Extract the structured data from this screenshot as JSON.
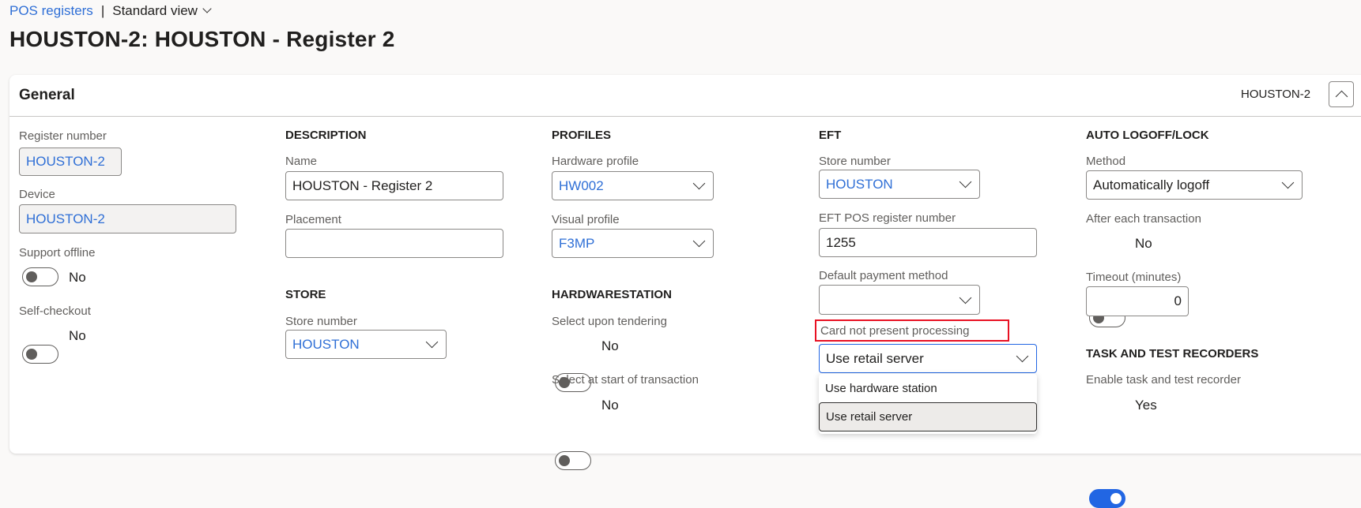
{
  "breadcrumb": {
    "link": "POS registers",
    "separator": "|",
    "view": "Standard view"
  },
  "title": "HOUSTON-2: HOUSTON - Register 2",
  "section": {
    "title": "General",
    "summary": "HOUSTON-2"
  },
  "col1": {
    "register_number_label": "Register number",
    "register_number": "HOUSTON-2",
    "device_label": "Device",
    "device": "HOUSTON-2",
    "support_offline_label": "Support offline",
    "support_offline": "No",
    "self_checkout_label": "Self-checkout",
    "self_checkout": "No"
  },
  "description": {
    "heading": "DESCRIPTION",
    "name_label": "Name",
    "name": "HOUSTON - Register 2",
    "placement_label": "Placement",
    "placement": ""
  },
  "store": {
    "heading": "STORE",
    "store_number_label": "Store number",
    "store_number": "HOUSTON"
  },
  "profiles": {
    "heading": "PROFILES",
    "hardware_label": "Hardware profile",
    "hardware": "HW002",
    "visual_label": "Visual profile",
    "visual": "F3MP"
  },
  "hardwarestation": {
    "heading": "HARDWARESTATION",
    "tender_label": "Select upon tendering",
    "tender": "No",
    "start_label": "Select at start of transaction",
    "start": "No"
  },
  "eft": {
    "heading": "EFT",
    "store_number_label": "Store number",
    "store_number": "HOUSTON",
    "register_label": "EFT POS register number",
    "register": "1255",
    "payment_label": "Default payment method",
    "payment": "",
    "cnp_label": "Card not present processing",
    "cnp": "Use retail server",
    "options": [
      "Use hardware station",
      "Use retail server"
    ]
  },
  "autologoff": {
    "heading": "AUTO LOGOFF/LOCK",
    "method_label": "Method",
    "method": "Automatically logoff",
    "after_label": "After each transaction",
    "after": "No",
    "timeout_label": "Timeout (minutes)",
    "timeout": "0"
  },
  "recorders": {
    "heading": "TASK AND TEST RECORDERS",
    "enable_label": "Enable task and test recorder",
    "enable": "Yes"
  }
}
